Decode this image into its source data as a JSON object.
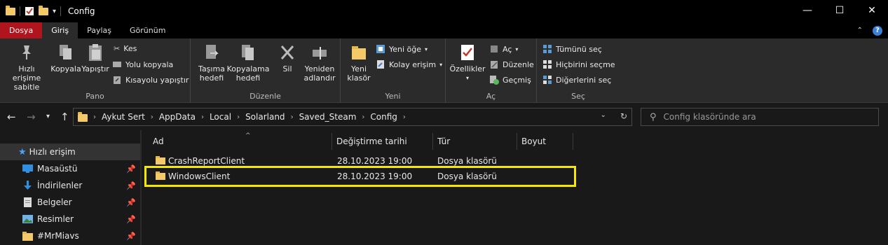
{
  "window": {
    "title": "Config",
    "controls": {
      "minimize": "—",
      "maximize": "☐",
      "close": "✕"
    }
  },
  "menu": {
    "tabs": [
      "Dosya",
      "Giriş",
      "Paylaş",
      "Görünüm"
    ]
  },
  "ribbon": {
    "pano": {
      "label": "Pano",
      "pin": "Hızlı erişime\nsabitle",
      "copy": "Kopyala",
      "paste": "Yapıştır",
      "cut": "Kes",
      "copy_path": "Yolu kopyala",
      "paste_shortcut": "Kısayolu yapıştır"
    },
    "duzenle": {
      "label": "Düzenle",
      "move_to": "Taşıma\nhedefi",
      "copy_to": "Kopyalama\nhedefi",
      "delete": "Sil",
      "rename": "Yeniden\nadlandır"
    },
    "yeni": {
      "label": "Yeni",
      "new_folder": "Yeni\nklasör",
      "new_item": "Yeni öğe",
      "easy_access": "Kolay erişim"
    },
    "ac": {
      "label": "Aç",
      "properties": "Özellikler",
      "open": "Aç",
      "edit": "Düzenle",
      "history": "Geçmiş"
    },
    "sec": {
      "label": "Seç",
      "select_all": "Tümünü seç",
      "select_none": "Hiçbirini seçme",
      "invert": "Diğerlerini seç"
    }
  },
  "address": {
    "crumbs": [
      "Aykut Sert",
      "AppData",
      "Local",
      "Solarland",
      "Saved_Steam",
      "Config"
    ],
    "search_placeholder": "Config klasöründe ara"
  },
  "nav": {
    "items": [
      {
        "label": "Hızlı erişim",
        "icon": "star-icon"
      },
      {
        "label": "Masaüstü",
        "icon": "desktop-icon"
      },
      {
        "label": "İndirilenler",
        "icon": "download-icon"
      },
      {
        "label": "Belgeler",
        "icon": "documents-icon"
      },
      {
        "label": "Resimler",
        "icon": "pictures-icon"
      },
      {
        "label": "#MrMiavs",
        "icon": "folder-icon"
      }
    ]
  },
  "files": {
    "columns": [
      "Ad",
      "Değiştirme tarihi",
      "Tür",
      "Boyut"
    ],
    "rows": [
      {
        "name": "CrashReportClient",
        "date": "28.10.2023 19:00",
        "type": "Dosya klasörü",
        "size": ""
      },
      {
        "name": "WindowsClient",
        "date": "28.10.2023 19:00",
        "type": "Dosya klasörü",
        "size": ""
      }
    ]
  },
  "colors": {
    "file_tab": "#b0141c",
    "highlight": "#f5e800",
    "folder": "#f3c96a",
    "accent": "#3b7fd6"
  }
}
